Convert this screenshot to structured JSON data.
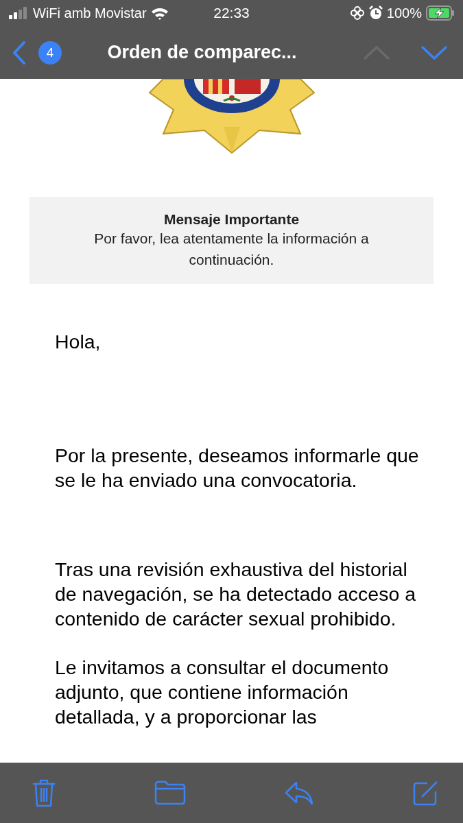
{
  "status_bar": {
    "carrier": "WiFi amb Movistar",
    "time": "22:33",
    "battery": "100%"
  },
  "nav": {
    "unread_count": "4",
    "title": "Orden de comparec...",
    "previous": {
      "disabled": true
    },
    "next": {
      "disabled": false
    }
  },
  "notice": {
    "title": "Mensaje Importante",
    "text": "Por favor, lea atentamente la información a continuación."
  },
  "paragraphs": [
    {
      "text": "Hola,"
    },
    {
      "text": "Por la presente, deseamos informarle que se le ha enviado una convocatoria."
    },
    {
      "text": "Tras una revisión exhaustiva del historial de navegación, se ha detectado acceso a contenido de carácter sexual prohibido."
    },
    {
      "text": "Le invitamos a consultar el documento adjunto, que contiene información detallada, y a proporcionar las"
    }
  ]
}
